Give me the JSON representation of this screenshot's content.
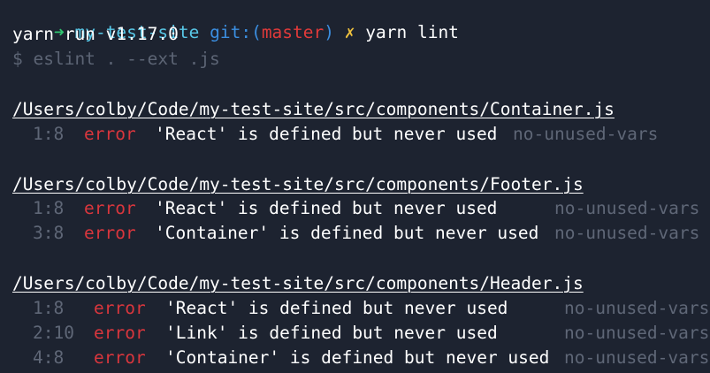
{
  "prompt": {
    "arrow": "➜",
    "directory": "my-test-site",
    "git_prefix": "git:(",
    "branch": "master",
    "git_suffix": ")",
    "dirty_mark": "✗",
    "command": "yarn lint"
  },
  "output": {
    "yarn_version": "yarn run v1.17.0",
    "script_command": "$ eslint . --ext .js"
  },
  "files": [
    {
      "path": "/Users/colby/Code/my-test-site/src/components/Container.js",
      "problems": [
        {
          "location": "1:8",
          "severity": "error",
          "message": "'React' is defined but never used",
          "rule": "no-unused-vars"
        }
      ]
    },
    {
      "path": "/Users/colby/Code/my-test-site/src/components/Footer.js",
      "problems": [
        {
          "location": "1:8",
          "severity": "error",
          "message": "'React' is defined but never used",
          "rule": "no-unused-vars"
        },
        {
          "location": "3:8",
          "severity": "error",
          "message": "'Container' is defined but never used",
          "rule": "no-unused-vars"
        }
      ]
    },
    {
      "path": "/Users/colby/Code/my-test-site/src/components/Header.js",
      "problems": [
        {
          "location": "1:8",
          "severity": "error",
          "message": "'React' is defined but never used",
          "rule": "no-unused-vars"
        },
        {
          "location": "2:10",
          "severity": "error",
          "message": "'Link' is defined but never used",
          "rule": "no-unused-vars"
        },
        {
          "location": "4:8",
          "severity": "error",
          "message": "'Container' is defined but never used",
          "rule": "no-unused-vars"
        }
      ]
    }
  ]
}
